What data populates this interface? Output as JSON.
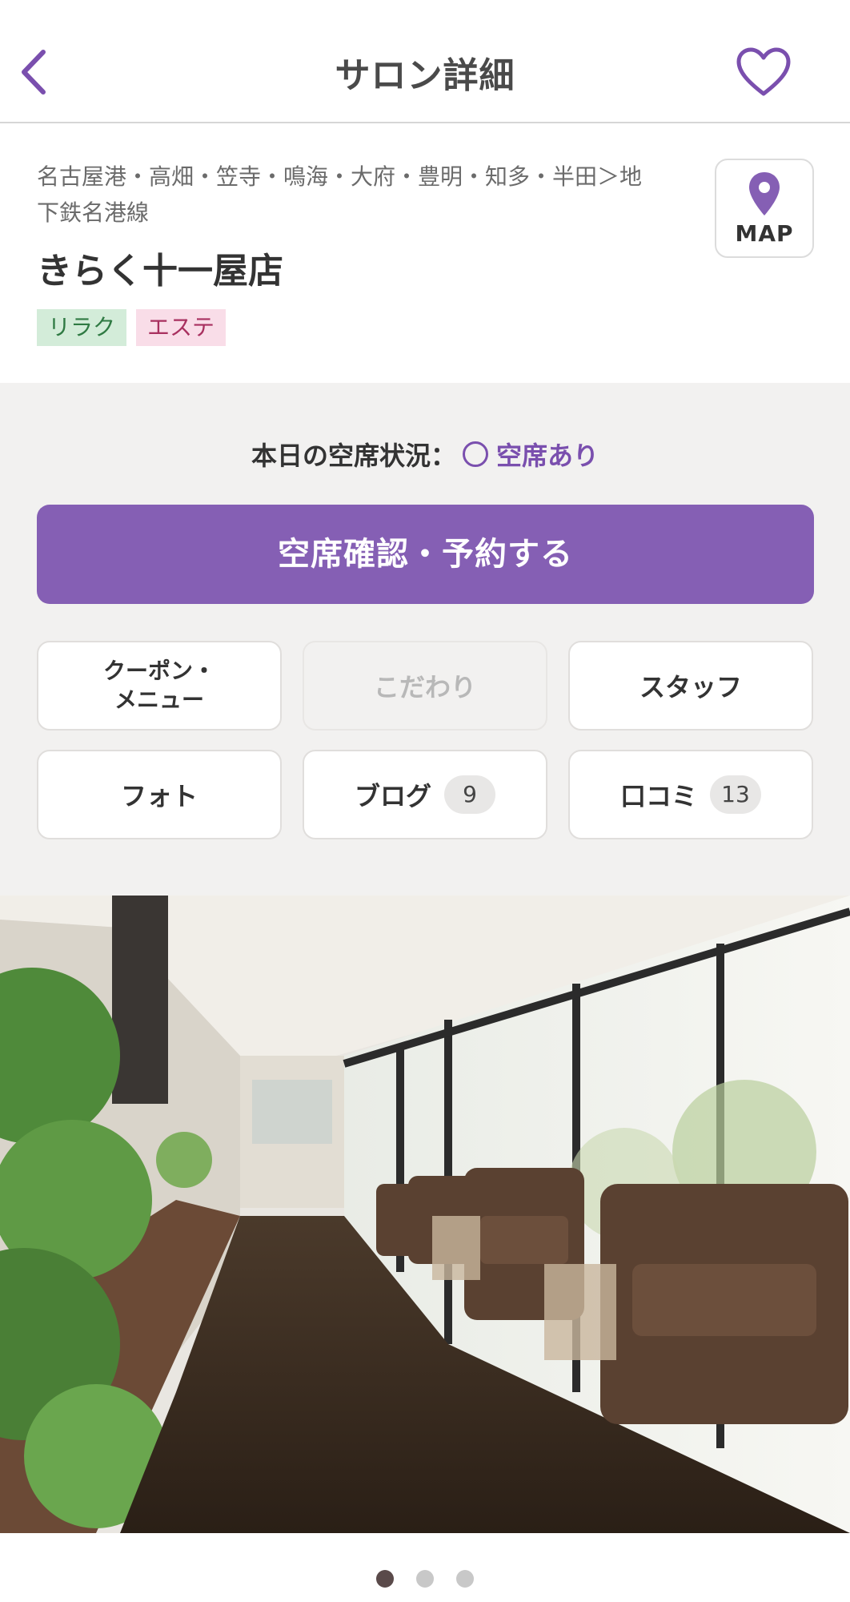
{
  "header": {
    "title": "サロン詳細",
    "back_icon": "chevron-left-icon",
    "favorite_icon": "heart-outline-icon"
  },
  "salon": {
    "area_line1": "名古屋港・高畑・笠寺・鳴海・大府・豊明・知多・半田＞地",
    "area_line2": "下鉄名港線",
    "name": "きらく十一屋店",
    "tags": [
      "リラク",
      "エステ"
    ],
    "map_label": "MAP",
    "map_icon": "map-pin-icon"
  },
  "booking": {
    "status_label": "本日の空席状況：",
    "status_value": "空席あり",
    "reserve_label": "空席確認・予約する"
  },
  "menu": {
    "coupon_line1": "クーポン・",
    "coupon_line2": "メニュー",
    "kodawari": "こだわり",
    "staff": "スタッフ",
    "photo": "フォト",
    "blog": "ブログ",
    "blog_count": "9",
    "reviews": "口コミ",
    "reviews_count": "13"
  },
  "carousel": {
    "total": 3,
    "active_index": 0
  },
  "colors": {
    "accent": "#855fb4",
    "accent_text": "#7a4fae",
    "tag_green_bg": "#d3ecd9",
    "tag_pink_bg": "#f9dde8",
    "section_bg": "#f2f1f0"
  }
}
